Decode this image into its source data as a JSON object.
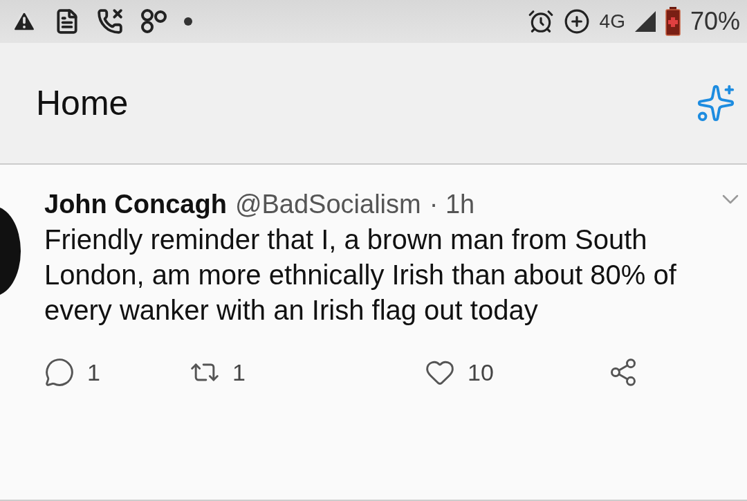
{
  "status_bar": {
    "network": "4G",
    "battery": "70%"
  },
  "header": {
    "title": "Home"
  },
  "tweet": {
    "name": "John Concagh",
    "handle": "@BadSocialism",
    "time": "· 1h",
    "text": "Friendly reminder that I, a brown man from South London, am more ethnically Irish than about 80% of every wanker with an Irish flag out today",
    "actions": [
      {
        "kind": "reply",
        "count": "1"
      },
      {
        "kind": "retweet",
        "count": "1"
      },
      {
        "kind": "like",
        "count": "10"
      },
      {
        "kind": "share"
      }
    ]
  }
}
